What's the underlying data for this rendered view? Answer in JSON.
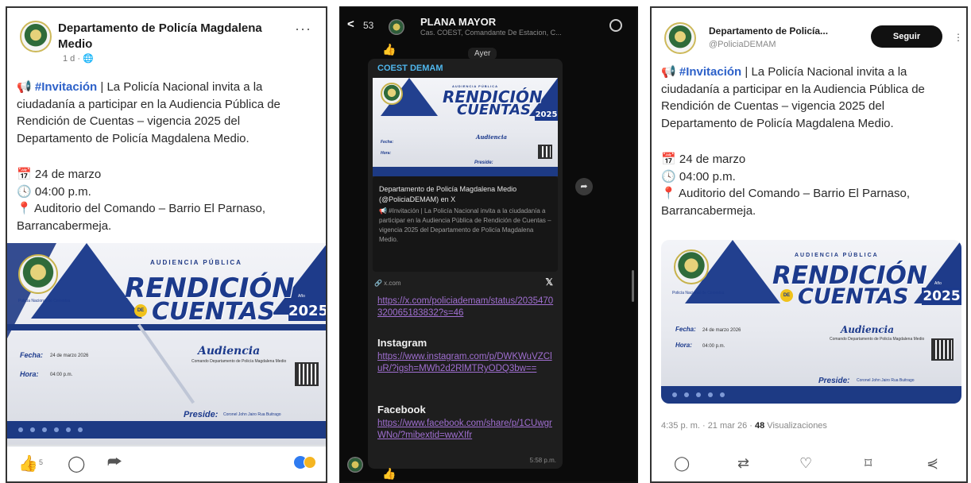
{
  "facebook": {
    "page_name": "Departamento de Policía Magdalena Medio",
    "time": "1 d · ",
    "more": "···",
    "post": {
      "emoji": "📢",
      "hashtag": "#Invitación",
      "body": " | La Policía Nacional invita a la ciudadanía a participar en la Audiencia Pública de Rendición de Cuentas – vigencia 2025 del Departamento de Policía Magdalena Medio.",
      "date": "24 de marzo",
      "hour": "04:00 p.m.",
      "place": "Auditorio del Comando – Barrio El Parnaso, Barrancabermeja."
    },
    "likes_count": "5"
  },
  "poster": {
    "kicker": "AUDIENCIA PÚBLICA",
    "title_line1": "RENDICIÓN",
    "de": "DE",
    "title_line2": "CUENTAS",
    "year_label": "Año",
    "year": "2025",
    "fecha_label": "Fecha:",
    "fecha_value": "24 de marzo 2026",
    "hora_label": "Hora:",
    "hora_value": "04:00 p.m.",
    "audiencia": "Audiencia",
    "audiencia_sub": "Comando Departamento de Policía Magdalena Medio",
    "preside_label": "Preside:",
    "preside_value": "Coronel John Jairo Rua Buitrago",
    "policia_label": "Policía Nacional de Colombia"
  },
  "whatsapp": {
    "back_count": "53",
    "group_title": "PLANA MAYOR",
    "group_sub": "Cas. COEST, Comandante De Estacion, C...",
    "day": "Ayer",
    "sender": "COEST DEMAM",
    "preview_title": "Departamento de Policía Magdalena Medio (@PoliciaDEMAM) en X",
    "preview_desc": "📢 #Invitación | La Policía Nacional invita a la ciudadanía a participar en la Audiencia Pública de Rendición de Cuentas – vigencia 2025 del Departamento de Policía Magdalena Medio.",
    "preview_site": "🔗 x.com",
    "preview_x": "𝕏",
    "link_x": "https://x.com/policiademam/status/2035470320065183832?s=46",
    "instagram_label": "Instagram",
    "link_instagram": "https://www.instagram.com/p/DWKWuVZCluR/?igsh=MWh2d2RlMTRyODQ3bw==",
    "facebook_label": "Facebook",
    "link_facebook": "https://www.facebook.com/share/p/1CUwgrWNo/?mibextid=wwXIfr",
    "time": "5:58 p.m."
  },
  "twitter": {
    "name": "Departamento de Policía...",
    "handle": "@PoliciaDEMAM",
    "follow": "Seguir",
    "post": {
      "emoji": "📢",
      "hashtag": "#Invitación",
      "body": " | La Policía Nacional invita a la ciudadanía a participar en la Audiencia Pública de Rendición de Cuentas – vigencia 2025 del Departamento de Policía Magdalena Medio.",
      "date": "24 de marzo",
      "hour": "04:00 p.m.",
      "place": "Auditorio del Comando – Barrio El Parnaso, Barrancabermeja."
    },
    "timestamp": "4:35 p. m. · 21 mar 26 · ",
    "views_count": "48",
    "views_label": " Visualizaciones"
  },
  "colors": {
    "accent_blue": "#1c3a8c",
    "hashtag_blue": "#2d61c9",
    "wa_link": "#a06fd1",
    "wa_sender": "#4fb6ec"
  }
}
